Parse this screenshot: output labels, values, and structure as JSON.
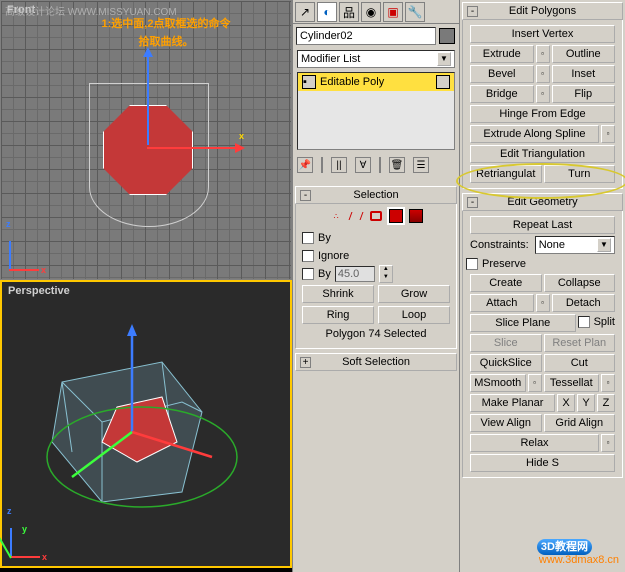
{
  "viewports": {
    "top": {
      "label": "Front"
    },
    "bottom": {
      "label": "Perspective"
    },
    "axis": {
      "x": "x",
      "y": "y",
      "z": "z"
    }
  },
  "annotation": {
    "line1": "1:选中面,2点取框选的命令",
    "line2": "拾取曲线。"
  },
  "watermarks": {
    "top": "高级设计论坛 WWW.MISSYUAN.COM",
    "badge": "3D教程网",
    "url": "www.3dmax8.cn"
  },
  "modifier_panel": {
    "object_name": "Cylinder02",
    "list_label": "Modifier List",
    "stack_item": "Editable Poly",
    "selection": {
      "title": "Selection",
      "by": "By",
      "ignore": "Ignore",
      "by_angle_label": "By",
      "by_angle_value": "45.0",
      "shrink": "Shrink",
      "grow": "Grow",
      "ring": "Ring",
      "loop": "Loop",
      "status": "Polygon 74 Selected"
    },
    "soft_selection": "Soft Selection"
  },
  "edit_poly": {
    "title": "Edit Polygons",
    "insert_vertex": "Insert Vertex",
    "extrude": "Extrude",
    "outline": "Outline",
    "bevel": "Bevel",
    "inset": "Inset",
    "bridge": "Bridge",
    "flip": "Flip",
    "hinge": "Hinge From Edge",
    "extrude_spline": "Extrude Along Spline",
    "edit_tri": "Edit Triangulation",
    "retri": "Retriangulat",
    "turn": "Turn"
  },
  "edit_geom": {
    "title": "Edit Geometry",
    "repeat": "Repeat Last",
    "constraints_lbl": "Constraints:",
    "constraints_val": "None",
    "preserve": "Preserve",
    "create": "Create",
    "collapse": "Collapse",
    "attach": "Attach",
    "detach": "Detach",
    "slice_plane": "Slice Plane",
    "split": "Split",
    "slice": "Slice",
    "reset_plane": "Reset Plan",
    "quickslice": "QuickSlice",
    "cut": "Cut",
    "msmooth": "MSmooth",
    "tessellate": "Tessellat",
    "make_planar": "Make Planar",
    "x": "X",
    "y": "Y",
    "z": "Z",
    "view_align": "View Align",
    "grid_align": "Grid Align",
    "relax": "Relax",
    "hide": "Hide S"
  }
}
